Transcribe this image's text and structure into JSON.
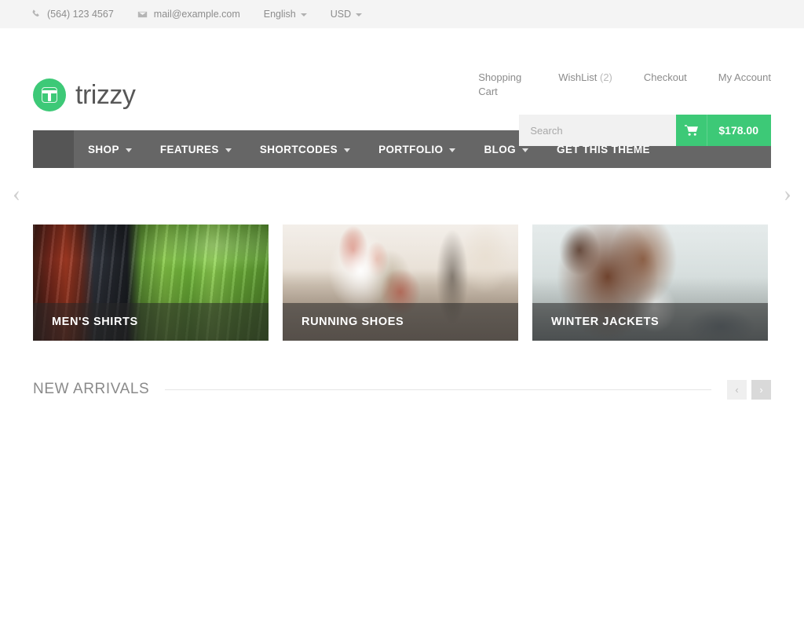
{
  "topbar": {
    "phone": "(564) 123 4567",
    "email": "mail@example.com",
    "language": "English",
    "currency": "USD",
    "phone_icon": "phone-icon",
    "mail_icon": "envelope-icon"
  },
  "brand": {
    "name": "trizzy",
    "logo_color": "#3dc977"
  },
  "header": {
    "links": [
      {
        "label": "Shopping Cart",
        "name": "shopping-cart-link"
      },
      {
        "label": "WishList",
        "count": "(2)",
        "name": "wishlist-link"
      },
      {
        "label": "Checkout",
        "name": "checkout-link"
      },
      {
        "label": "My Account",
        "name": "my-account-link"
      }
    ],
    "search": {
      "placeholder": "Search",
      "value": "",
      "button_icon": "search-icon"
    },
    "cart": {
      "total": "$178.00",
      "icon": "shopping-cart-icon",
      "color": "#3dc977"
    }
  },
  "nav": {
    "home_label": "",
    "items": [
      {
        "label": "SHOP",
        "has_dropdown": true
      },
      {
        "label": "FEATURES",
        "has_dropdown": true
      },
      {
        "label": "SHORTCODES",
        "has_dropdown": true
      },
      {
        "label": "PORTFOLIO",
        "has_dropdown": true
      },
      {
        "label": "BLOG",
        "has_dropdown": true
      },
      {
        "label": "GET THIS THEME",
        "has_dropdown": false
      }
    ],
    "background": "#666666"
  },
  "slider": {
    "prev_icon": "chevron-left-icon",
    "prev_glyph": "‹",
    "next_icon": "chevron-right-icon",
    "next_glyph": "›"
  },
  "banners": [
    {
      "label": "MEN'S SHIRTS",
      "image": "stacked-folded-shirts-red-green"
    },
    {
      "label": "RUNNING SHOES",
      "image": "running-shoes-on-pavement"
    },
    {
      "label": "WINTER JACKETS",
      "image": "person-in-brown-winter-jacket"
    }
  ],
  "new_arrivals": {
    "title": "NEW ARRIVALS",
    "prev_glyph": "‹",
    "next_glyph": "›",
    "products": []
  }
}
